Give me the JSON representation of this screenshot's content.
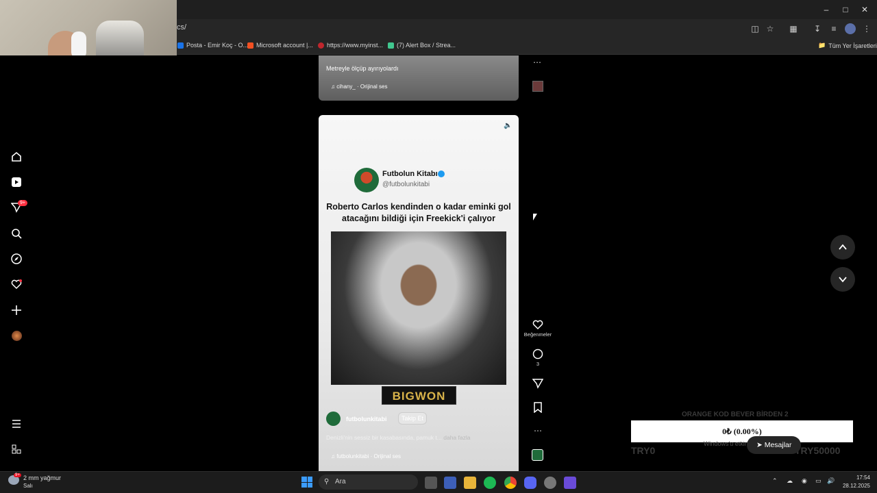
{
  "browser": {
    "url_fragment": "cs/",
    "bookmarks": [
      {
        "label": "Posta - Emir Koç - O...",
        "color": "#1a73e8"
      },
      {
        "label": "Microsoft account |...",
        "color": "#f25022"
      },
      {
        "label": "https://www.myinst...",
        "color": "#c0262d"
      },
      {
        "label": "(7) Alert Box / Strea...",
        "color": "#41c78f"
      }
    ],
    "all_bookmarks_label": "Tüm Yer İşaretleri"
  },
  "reel_prev": {
    "caption": "Metreyle ölçüp ayırıyolardı",
    "audio": "cihany_ · Orijinal ses"
  },
  "reel": {
    "account_name": "Futbolun Kitabı",
    "account_handle": "@futbolunkitabi",
    "headline": "Roberto Carlos kendinden o kadar eminki gol atacağını bildiği için Freekick'i çalıyor",
    "sponsor": "BIGWON",
    "username": "futbolunkitabi",
    "follow_label": "Takip Et",
    "caption": "Denizli'nin sessiz bir kasabasında, pamuk t...",
    "more_label": "daha fazla",
    "audio": "futbolunkitabi · Orijinal ses"
  },
  "actions": {
    "likes_label": "Beğenmeler",
    "comments_count": "3"
  },
  "sidebar": {
    "notification_badge": "9+"
  },
  "overlay": {
    "progress_text": "0₺ (0.00%)",
    "ghost_left": "TRY0",
    "ghost_right": "TRY50000",
    "ghost_top": "ORANGE KOD BEVER BİRDEN 2",
    "windows_notice": "Windows'u etkinleştir...",
    "messages_label": "Mesajlar"
  },
  "taskbar": {
    "weather_temp": "2 mm yağmur",
    "weather_day": "Salı",
    "search_placeholder": "Ara",
    "time": "17:54",
    "date": "28.12.2025",
    "weather_badge": "9+"
  },
  "colors": {
    "accent": "#ff3040",
    "verified": "#1d9bf0",
    "bigwon": "#d9b34a"
  }
}
